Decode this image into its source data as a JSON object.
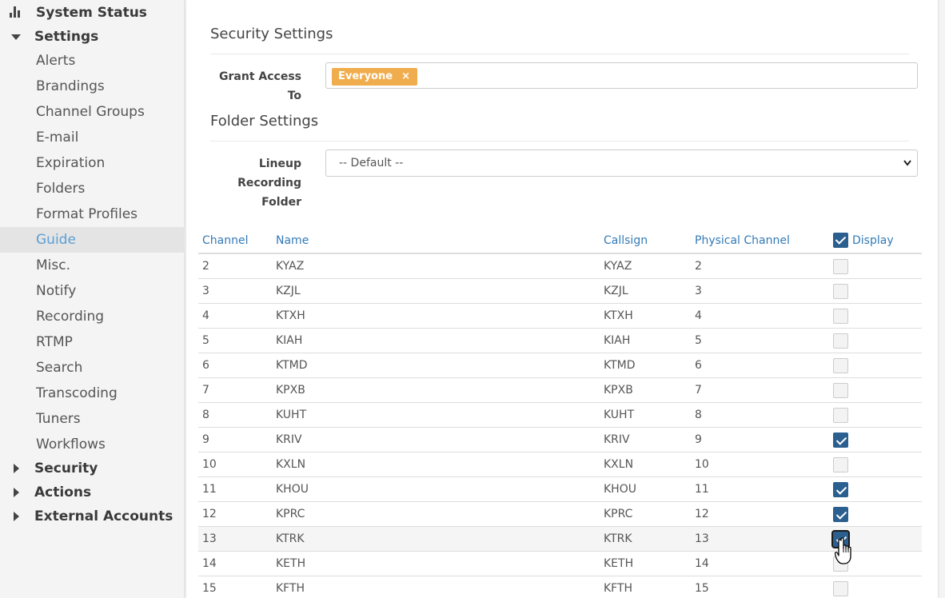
{
  "sidebar": {
    "system_status": "System Status",
    "settings": "Settings",
    "items": [
      "Alerts",
      "Brandings",
      "Channel Groups",
      "E-mail",
      "Expiration",
      "Folders",
      "Format Profiles",
      "Guide",
      "Misc.",
      "Notify",
      "Recording",
      "RTMP",
      "Search",
      "Transcoding",
      "Tuners",
      "Workflows"
    ],
    "active_item": "Guide",
    "security": "Security",
    "actions": "Actions",
    "external_accounts": "External Accounts"
  },
  "security_settings": {
    "title": "Security Settings",
    "grant_label": "Grant Access To",
    "tag": "Everyone",
    "tag_remove": "×"
  },
  "folder_settings": {
    "title": "Folder Settings",
    "lineup_label_1": "Lineup Recording",
    "lineup_label_2": "Folder",
    "select_value": "-- Default --"
  },
  "table": {
    "headers": {
      "channel": "Channel",
      "name": "Name",
      "callsign": "Callsign",
      "physical": "Physical Channel",
      "display": "Display"
    },
    "header_display_checked": true,
    "rows": [
      {
        "channel": "2",
        "name": "KYAZ",
        "callsign": "KYAZ",
        "physical": "2",
        "display": false
      },
      {
        "channel": "3",
        "name": "KZJL",
        "callsign": "KZJL",
        "physical": "3",
        "display": false
      },
      {
        "channel": "4",
        "name": "KTXH",
        "callsign": "KTXH",
        "physical": "4",
        "display": false
      },
      {
        "channel": "5",
        "name": "KIAH",
        "callsign": "KIAH",
        "physical": "5",
        "display": false
      },
      {
        "channel": "6",
        "name": "KTMD",
        "callsign": "KTMD",
        "physical": "6",
        "display": false
      },
      {
        "channel": "7",
        "name": "KPXB",
        "callsign": "KPXB",
        "physical": "7",
        "display": false
      },
      {
        "channel": "8",
        "name": "KUHT",
        "callsign": "KUHT",
        "physical": "8",
        "display": false
      },
      {
        "channel": "9",
        "name": "KRIV",
        "callsign": "KRIV",
        "physical": "9",
        "display": true
      },
      {
        "channel": "10",
        "name": "KXLN",
        "callsign": "KXLN",
        "physical": "10",
        "display": false
      },
      {
        "channel": "11",
        "name": "KHOU",
        "callsign": "KHOU",
        "physical": "11",
        "display": true
      },
      {
        "channel": "12",
        "name": "KPRC",
        "callsign": "KPRC",
        "physical": "12",
        "display": true
      },
      {
        "channel": "13",
        "name": "KTRK",
        "callsign": "KTRK",
        "physical": "13",
        "display": true
      },
      {
        "channel": "14",
        "name": "KETH",
        "callsign": "KETH",
        "physical": "14",
        "display": false
      },
      {
        "channel": "15",
        "name": "KFTH",
        "callsign": "KFTH",
        "physical": "15",
        "display": false
      }
    ]
  },
  "colors": {
    "link_blue": "#337ab7",
    "tag_orange": "#f0ad4e",
    "checkbox_blue": "#2b5f8f",
    "active_nav": "#5a9fd6"
  }
}
